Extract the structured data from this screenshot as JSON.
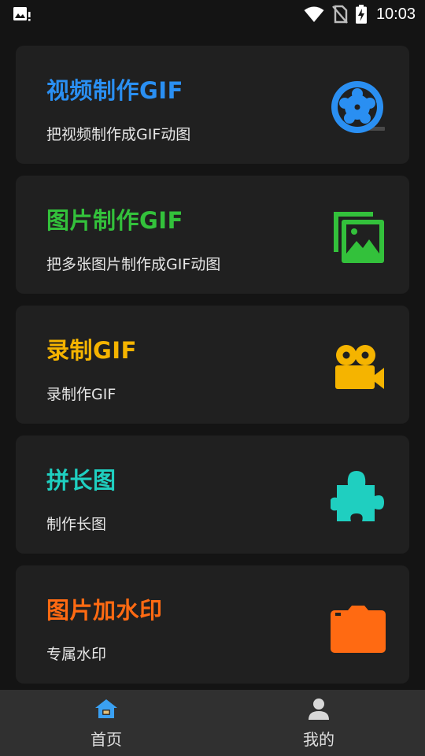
{
  "status_bar": {
    "time": "10:03",
    "icons": [
      "gallery-notification-icon",
      "wifi-icon",
      "no-sim-icon",
      "battery-charging-icon"
    ]
  },
  "cards": [
    {
      "title": "视频制作GIF",
      "subtitle": "把视频制作成GIF动图",
      "color": "#2a8ff2",
      "icon": "film-reel-icon"
    },
    {
      "title": "图片制作GIF",
      "subtitle": "把多张图片制作成GIF动图",
      "color": "#33c13b",
      "icon": "images-icon"
    },
    {
      "title": "录制GIF",
      "subtitle": "录制作GIF",
      "color": "#f5b400",
      "icon": "video-camera-icon"
    },
    {
      "title": "拼长图",
      "subtitle": "制作长图",
      "color": "#1fcfc0",
      "icon": "puzzle-icon"
    },
    {
      "title": "图片加水印",
      "subtitle": "专属水印",
      "color": "#ff6a12",
      "icon": "camera-icon"
    }
  ],
  "bottom_nav": [
    {
      "label": "首页",
      "icon": "home-icon",
      "active": true,
      "color": "#3aa0f2"
    },
    {
      "label": "我的",
      "icon": "person-icon",
      "active": false,
      "color": "#d8d8d8"
    }
  ]
}
